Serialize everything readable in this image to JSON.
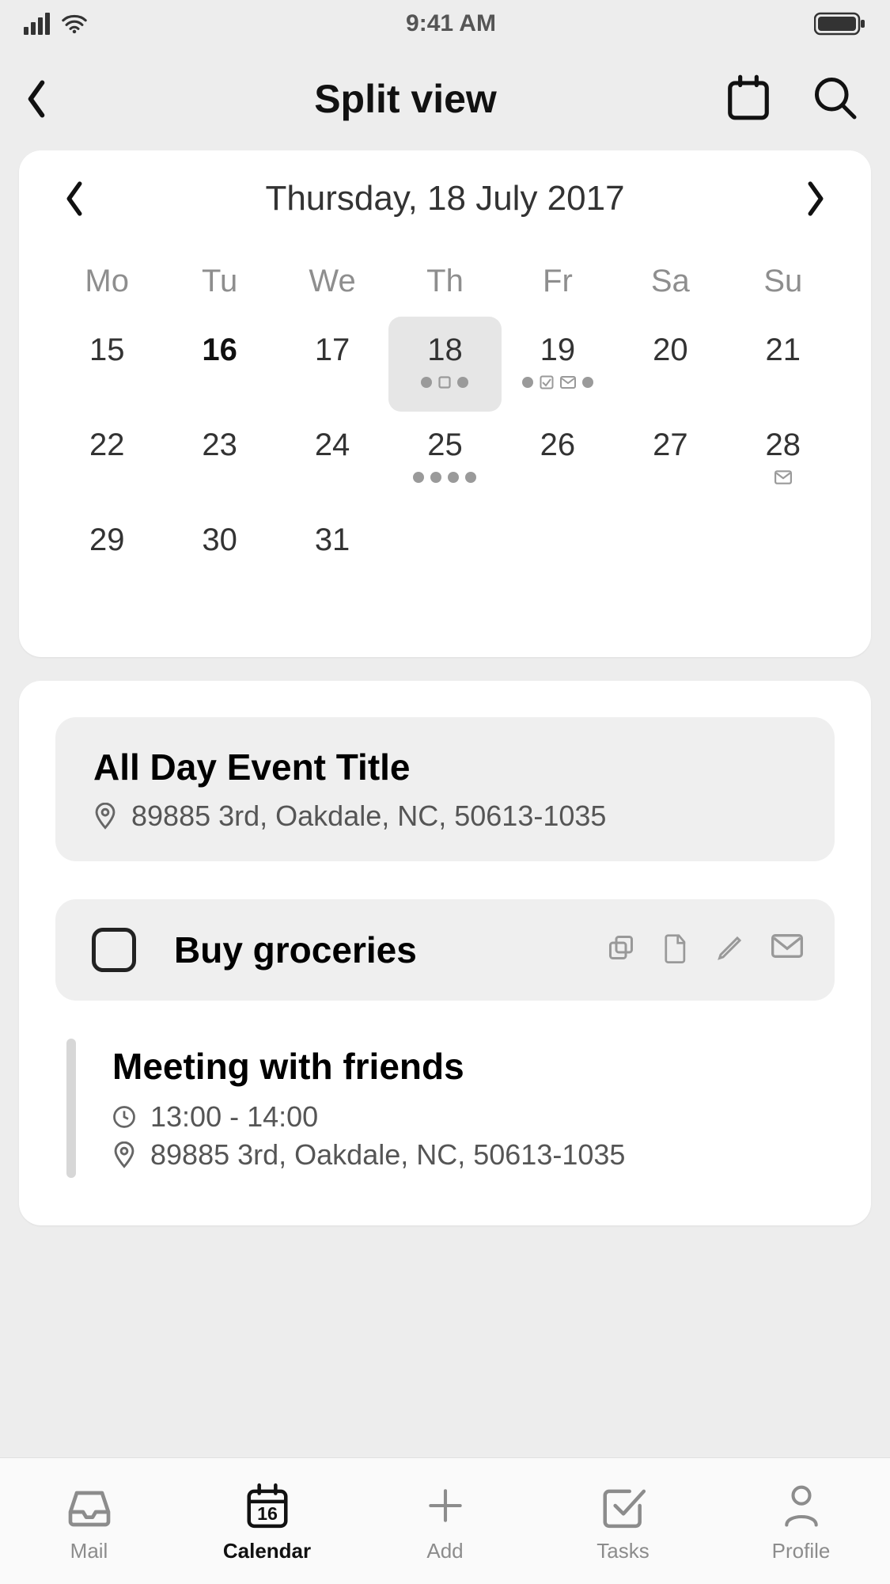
{
  "statusbar": {
    "time": "9:41 AM"
  },
  "header": {
    "title": "Split view"
  },
  "calendar": {
    "date_label": "Thursday, 18 July 2017",
    "weekdays": [
      "Mo",
      "Tu",
      "We",
      "Th",
      "Fr",
      "Sa",
      "Su"
    ],
    "days": {
      "d15": "15",
      "d16": "16",
      "d17": "17",
      "d18": "18",
      "d19": "19",
      "d20": "20",
      "d21": "21",
      "d22": "22",
      "d23": "23",
      "d24": "24",
      "d25": "25",
      "d26": "26",
      "d27": "27",
      "d28": "28",
      "d29": "29",
      "d30": "30",
      "d31": "31"
    }
  },
  "events": {
    "allday": {
      "title": "All Day Event Title",
      "location": "89885 3rd, Oakdale, NC, 50613-1035"
    },
    "task": {
      "title": "Buy groceries"
    },
    "timed": {
      "title": "Meeting with friends",
      "time": "13:00 - 14:00",
      "location": "89885 3rd, Oakdale, NC, 50613-1035"
    }
  },
  "tabs": {
    "mail": "Mail",
    "calendar": "Calendar",
    "add": "Add",
    "tasks": "Tasks",
    "profile": "Profile",
    "calendar_daynum": "16"
  }
}
